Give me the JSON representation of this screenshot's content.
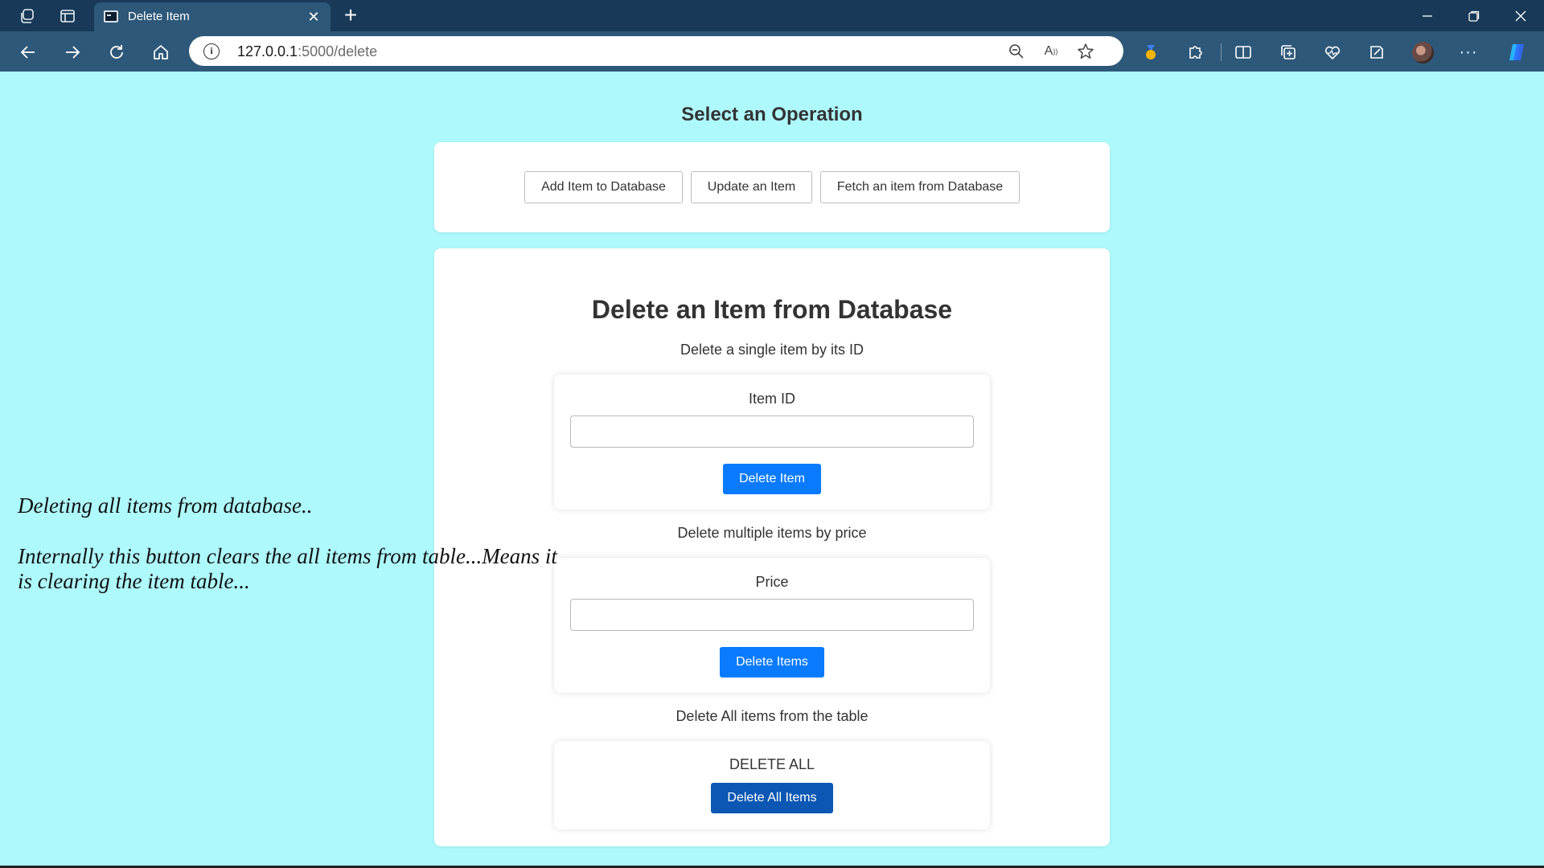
{
  "browser": {
    "tab_title": "Delete Item",
    "url_host": "127.0.0.1",
    "url_path": ":5000/delete"
  },
  "page": {
    "operation_title": "Select an Operation",
    "operations": [
      {
        "label": "Add Item to Database"
      },
      {
        "label": "Update an Item"
      },
      {
        "label": "Fetch an item from Database"
      }
    ],
    "heading": "Delete an Item from Database",
    "single": {
      "description": "Delete a single item by its ID",
      "label": "Item ID",
      "value": "",
      "button": "Delete Item"
    },
    "multiple": {
      "description": "Delete multiple items by price",
      "label": "Price",
      "value": "",
      "button": "Delete Items"
    },
    "all": {
      "description": "Delete All items from the table",
      "label": "DELETE ALL",
      "button": "Delete All Items"
    }
  },
  "annotation": {
    "line1": "Deleting all items from database..",
    "line2": "Internally this button clears the all items from table...Means it",
    "line3": "is clearing the item table..."
  },
  "colors": {
    "page_background": "#aef9fc",
    "primary_button": "#0a7bff",
    "delete_all_button": "#0b57b3",
    "browser_tabbar": "#183a58",
    "browser_toolbar": "#2e5879"
  }
}
